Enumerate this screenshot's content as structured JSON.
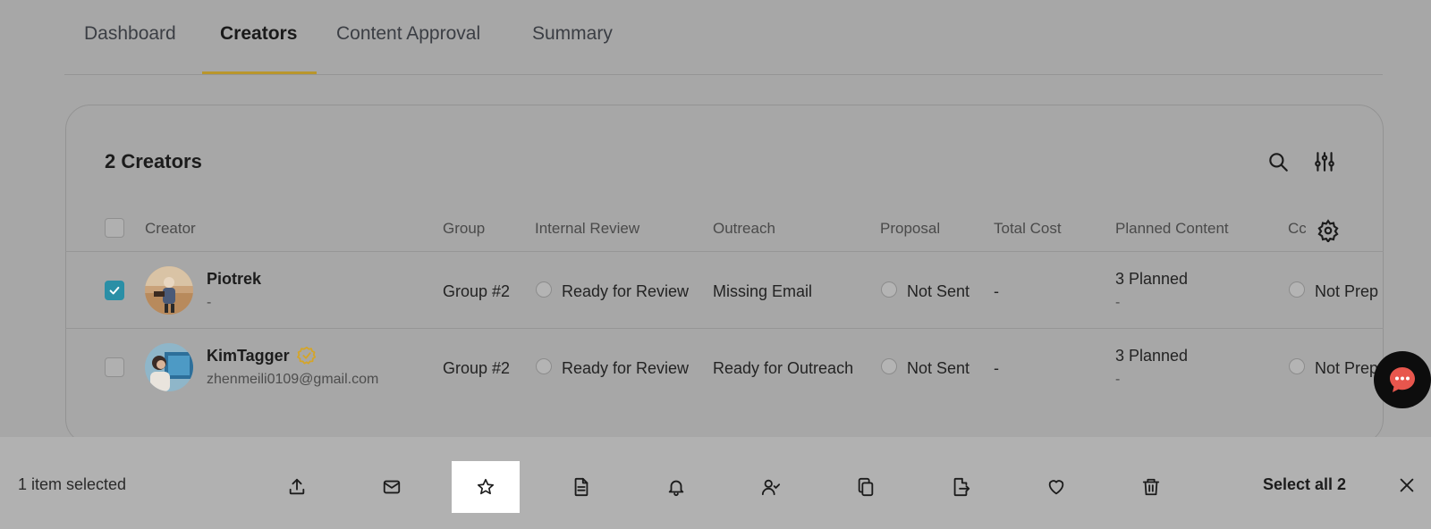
{
  "tabs": [
    {
      "label": "Dashboard"
    },
    {
      "label": "Creators"
    },
    {
      "label": "Content Approval"
    },
    {
      "label": "Summary"
    }
  ],
  "table": {
    "title": "2 Creators",
    "headers": {
      "creator": "Creator",
      "group": "Group",
      "internal_review": "Internal Review",
      "outreach": "Outreach",
      "proposal": "Proposal",
      "total_cost": "Total Cost",
      "planned_content": "Planned Content",
      "truncated": "Cc"
    },
    "rows": [
      {
        "checked": true,
        "name": "Piotrek",
        "sub": "-",
        "group": "Group #2",
        "internal_review": "Ready for Review",
        "outreach": "Missing Email",
        "proposal": "Not Sent",
        "total_cost": "-",
        "planned": "3 Planned",
        "planned_sub": "-",
        "next_col": "Not Prep"
      },
      {
        "checked": false,
        "name": "KimTagger",
        "verified": true,
        "sub": "zhenmeili0109@gmail.com",
        "group": "Group #2",
        "internal_review": "Ready for Review",
        "outreach": "Ready for Outreach",
        "proposal": "Not Sent",
        "total_cost": "-",
        "planned": "3 Planned",
        "planned_sub": "-",
        "next_col": "Not Prep"
      }
    ]
  },
  "bottom_bar": {
    "selected_text": "1 item selected",
    "select_all": "Select all 2",
    "actions": [
      {
        "icon": "upload-icon"
      },
      {
        "icon": "mail-icon"
      },
      {
        "icon": "star-icon",
        "highlighted": true
      },
      {
        "icon": "document-icon"
      },
      {
        "icon": "bell-icon"
      },
      {
        "icon": "user-check-icon"
      },
      {
        "icon": "copy-icon"
      },
      {
        "icon": "file-export-icon"
      },
      {
        "icon": "heart-icon"
      },
      {
        "icon": "trash-icon"
      }
    ]
  },
  "colors": {
    "accent_underline": "#b9962c",
    "checkbox_checked": "#2b8fa6",
    "verified_badge": "#d4a52a",
    "chat_button": "#0d0d0d",
    "chat_bubble": "#e8564d"
  }
}
